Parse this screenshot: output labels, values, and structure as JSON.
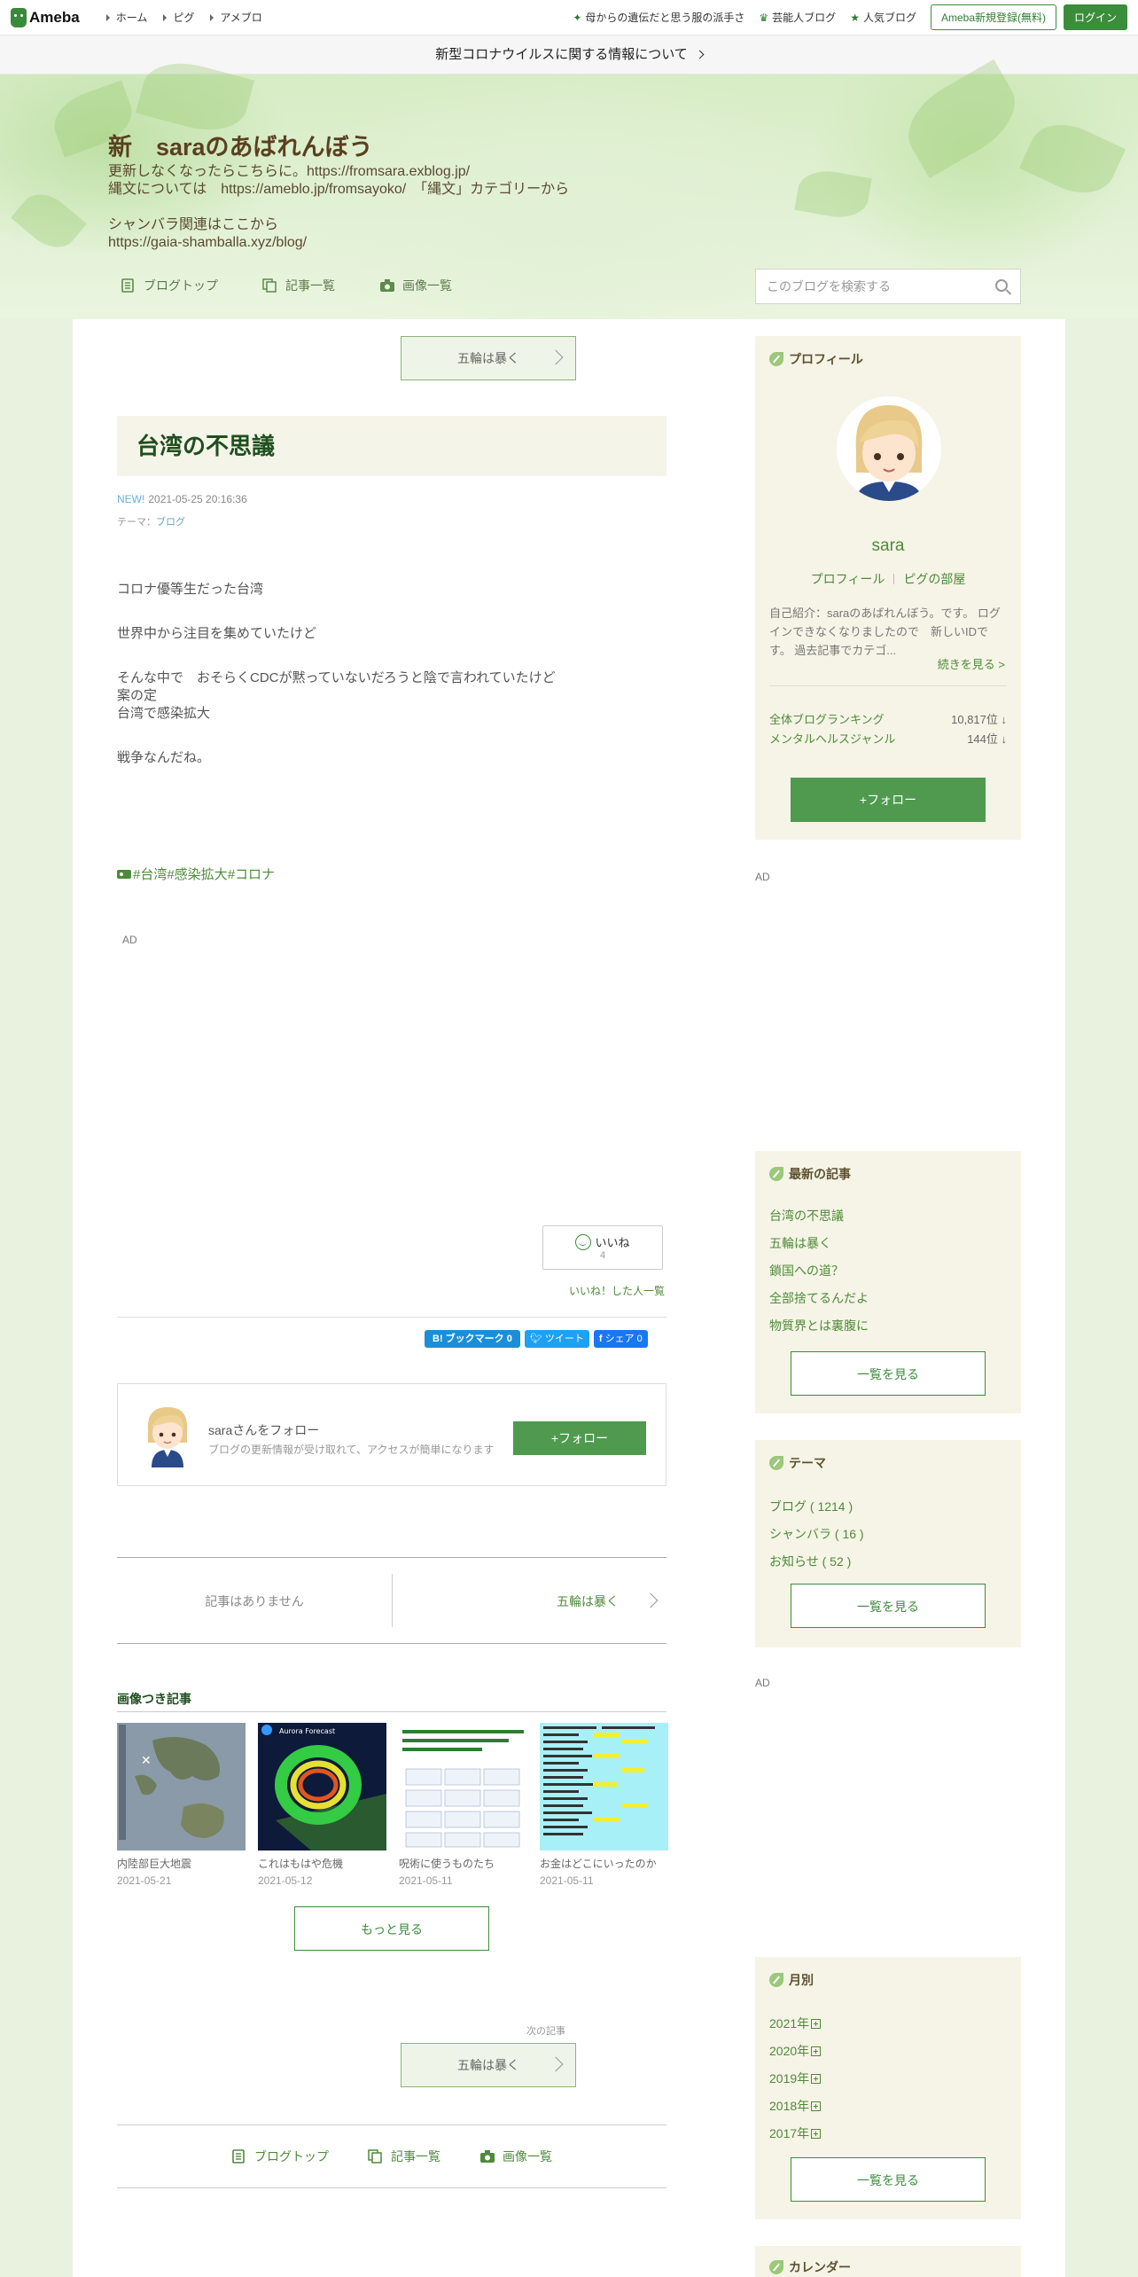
{
  "topbar": {
    "logo": "Ameba",
    "nav_left": [
      "ホーム",
      "ピグ",
      "アメブロ"
    ],
    "nav_right": [
      {
        "icon": "sparkle-icon",
        "label": "母からの遺伝だと思う服の派手さ"
      },
      {
        "icon": "crown-icon",
        "label": "芸能人ブログ"
      },
      {
        "icon": "star-icon",
        "label": "人気ブログ"
      }
    ],
    "register_label": "Ameba新規登録(無料)",
    "login_label": "ログイン"
  },
  "banner": {
    "text": "新型コロナウイルスに関する情報について"
  },
  "header": {
    "title": "新　saraのあばれんぼう",
    "description": "更新しなくなったらこちらに。https://fromsara.exblog.jp/\n縄文については　https://ameblo.jp/fromsayoko/　「縄文」カテゴリーから\n\nシャンバラ関連はここから\nhttps://gaia-shamballa.xyz/blog/",
    "nav": [
      "ブログトップ",
      "記事一覧",
      "画像一覧"
    ],
    "search_placeholder": "このブログを検索する"
  },
  "article": {
    "top_next_label": "五輪は暴く",
    "title": "台湾の不思議",
    "new_badge": "NEW!",
    "datetime": "2021-05-25 20:16:36",
    "theme_prefix": "テーマ：",
    "theme": "ブログ",
    "paragraphs": [
      "コロナ優等生だった台湾",
      "",
      "世界中から注目を集めていたけど",
      "",
      "そんな中で　おそらくCDCが黙っていないだろうと陰で言われていたけど",
      "案の定",
      "台湾で感染拡大",
      "",
      "戦争なんだね。"
    ],
    "tags": [
      "#台湾",
      "#感染拡大",
      "#コロナ"
    ],
    "ad_label": "AD",
    "like_label": "いいね",
    "like_count": "4",
    "like_list": "いいね！した人一覧",
    "shares": [
      {
        "label": "B! ブックマーク  0",
        "color": "#1a8fd8"
      },
      {
        "label": "ツイート",
        "color": "#1da1f2"
      },
      {
        "label": "シェア 0",
        "color": "#1877f2"
      }
    ],
    "follow_name": "saraさんをフォロー",
    "follow_sub": "ブログの更新情報が受け取れて、アクセスが簡単になります",
    "follow_button": "+フォロー",
    "prev_label": "記事はありません",
    "next_label": "五輪は暴く"
  },
  "image_articles": {
    "title": "画像つき記事",
    "items": [
      {
        "caption": "内陸部巨大地震",
        "date": "2021-05-21"
      },
      {
        "caption": "これはもはや危機",
        "date": "2021-05-12"
      },
      {
        "caption": "呪術に使うものたち",
        "date": "2021-05-11"
      },
      {
        "caption": "お金はどこにいったのか",
        "date": "2021-05-11"
      }
    ],
    "more_label": "もっと見る"
  },
  "next_article": {
    "small_label": "次の記事",
    "label": "五輪は暴く"
  },
  "bottom_nav": [
    "ブログトップ",
    "記事一覧",
    "画像一覧"
  ],
  "sidebar": {
    "profile": {
      "heading": "プロフィール",
      "name": "sara",
      "links": [
        "プロフィール",
        "ピグの部屋"
      ],
      "intro": "自己紹介：saraのあばれんぼう。です。 ログインできなくなりましたので　新しいIDです。 過去記事でカテゴ...",
      "more": "続きを見る >",
      "rankings": [
        {
          "label": "全体ブログランキング",
          "value": "10,817位 ↓"
        },
        {
          "label": "メンタルヘルスジャンル",
          "value": "144位 ↓"
        }
      ],
      "follow_button": "+フォロー"
    },
    "ad_label": "AD",
    "latest": {
      "heading": "最新の記事",
      "items": [
        "台湾の不思議",
        "五輪は暴く",
        "鎖国への道？",
        "全部捨てるんだよ",
        "物質界とは裏腹に"
      ],
      "more": "一覧を見る"
    },
    "themes": {
      "heading": "テーマ",
      "items": [
        "ブログ ( 1214 )",
        "シャンバラ ( 16 )",
        "お知らせ ( 52 )"
      ],
      "more": "一覧を見る"
    },
    "monthly": {
      "heading": "月別",
      "items": [
        "2021年",
        "2020年",
        "2019年",
        "2018年",
        "2017年"
      ],
      "more": "一覧を見る"
    },
    "calendar": {
      "heading": "カレンダー"
    }
  }
}
